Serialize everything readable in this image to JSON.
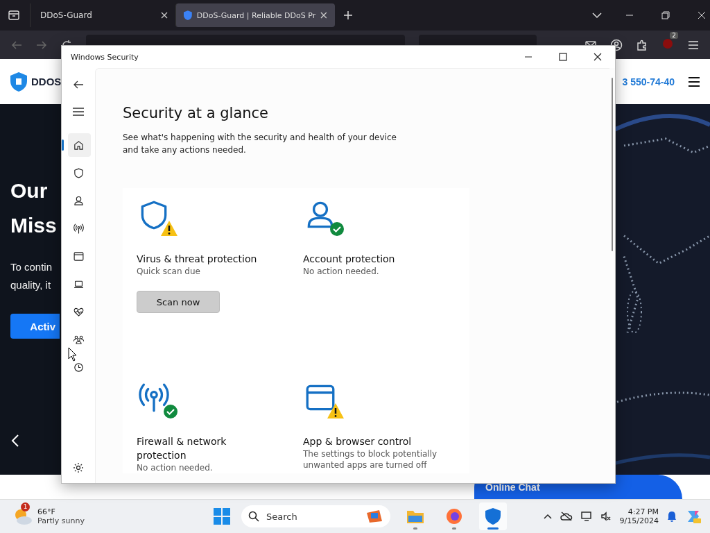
{
  "browser": {
    "tabs": [
      {
        "title": "DDoS-Guard",
        "selected": false
      },
      {
        "title": "DDoS-Guard | Reliable DDoS Pr",
        "selected": true
      }
    ],
    "extension_badge": "2"
  },
  "website": {
    "logo": "DDOS",
    "phone": "3 550-74-40",
    "headline": [
      "Our",
      "Miss"
    ],
    "body": [
      "To contin",
      "quality, it"
    ],
    "button": "Activ",
    "chat": "Online Chat"
  },
  "window": {
    "title": "Windows Security",
    "heading": "Security at a glance",
    "intro": "See what's happening with the security and health of your device and take any actions needed.",
    "nav": [
      {
        "kind": "home",
        "selected": true
      },
      {
        "kind": "shield",
        "selected": false
      },
      {
        "kind": "person",
        "selected": false
      },
      {
        "kind": "antenna",
        "selected": false
      },
      {
        "kind": "window",
        "selected": false
      },
      {
        "kind": "laptop",
        "selected": false
      },
      {
        "kind": "heart",
        "selected": false
      },
      {
        "kind": "family",
        "selected": false
      },
      {
        "kind": "history",
        "selected": false
      }
    ],
    "cards": [
      {
        "kind": "shield",
        "warning": true,
        "title": "Virus & threat protection",
        "status": "Quick scan due",
        "action": "Scan now"
      },
      {
        "kind": "person",
        "warning": false,
        "title": "Account protection",
        "status": "No action needed."
      },
      {
        "kind": "antenna",
        "warning": false,
        "title": "Firewall & network protection",
        "status": "No action needed."
      },
      {
        "kind": "window",
        "warning": true,
        "title": "App & browser control",
        "status": "The settings to block potentially unwanted apps are turned off"
      }
    ]
  },
  "taskbar": {
    "weather": {
      "alerts": "1",
      "temp": "66°F",
      "condition": "Partly sunny"
    },
    "search": "Search",
    "apps": [
      {
        "kind": "folder",
        "active": false
      },
      {
        "kind": "browser",
        "active": false
      },
      {
        "kind": "shield",
        "active": true
      }
    ],
    "time": "4:27 PM",
    "date": "9/15/2024"
  }
}
